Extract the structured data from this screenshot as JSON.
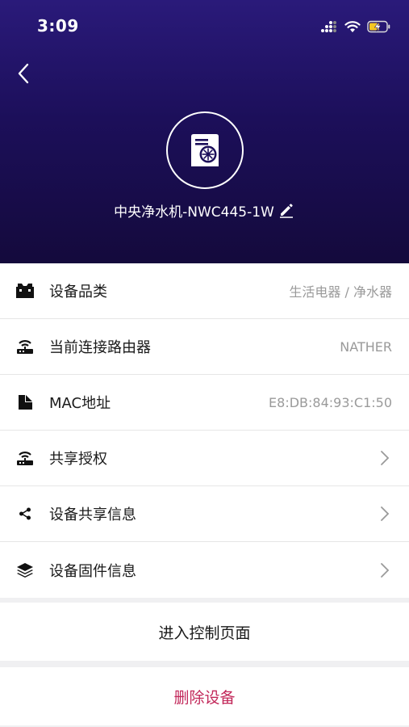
{
  "status_bar": {
    "time": "3:09"
  },
  "header": {
    "device_name": "中央净水机-NWC445-1W"
  },
  "rows": [
    {
      "label": "设备品类",
      "value": "生活电器 / 净水器",
      "icon": "category-icon"
    },
    {
      "label": "当前连接路由器",
      "value": "NATHER",
      "icon": "router-icon"
    },
    {
      "label": "MAC地址",
      "value": "E8:DB:84:93:C1:50",
      "icon": "sd-card-icon"
    },
    {
      "label": "共享授权",
      "value": "",
      "icon": "router-icon"
    },
    {
      "label": "设备共享信息",
      "value": "",
      "icon": "share-icon"
    },
    {
      "label": "设备固件信息",
      "value": "",
      "icon": "layers-icon"
    }
  ],
  "actions": {
    "enter_control": "进入控制页面",
    "delete_device": "删除设备",
    "delete_color": "#c2285a"
  },
  "colors": {
    "header_top": "#2a1a7a",
    "header_bottom": "#140a3c"
  }
}
